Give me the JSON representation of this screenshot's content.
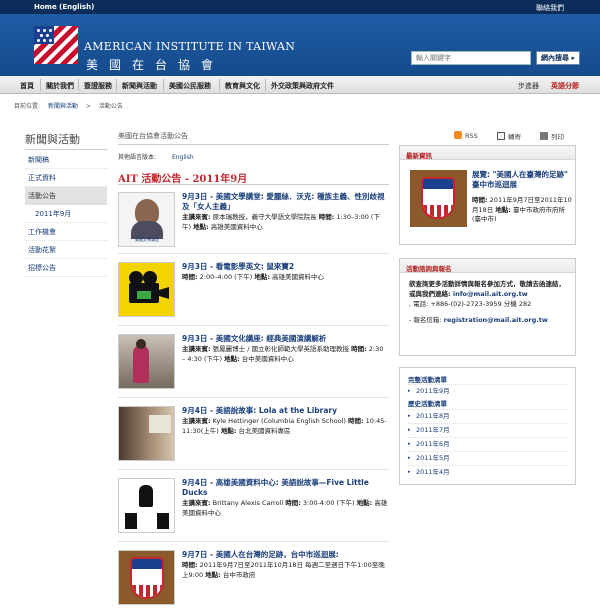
{
  "topbar": {
    "home": "Home (English)",
    "contact": "聯絡我們"
  },
  "brand": {
    "en": "AMERICAN INSTITUTE IN TAIWAN",
    "zh": "美國在台協會"
  },
  "search": {
    "placeholder": "輸入關鍵字",
    "button": "網內搜尋 ▸"
  },
  "nav": {
    "items": [
      "首頁",
      "關於我們",
      "簽證服務",
      "新聞與活動",
      "美國公民服務",
      "教育與文化",
      "外交政策與政府文件"
    ],
    "lang_simplified": "步進器",
    "lang_english": "英語分節"
  },
  "breadcrumb": {
    "label": "目前位置:",
    "level1": "新聞與活動",
    "arrow": ">",
    "level2": "活動公告"
  },
  "sidebar": {
    "title": "新聞與活動",
    "items": [
      "新聞稿",
      "正式資料",
      "活動公告",
      "2011年9月",
      "工作機會",
      "活動花絮",
      "招標公告"
    ]
  },
  "main": {
    "heading": "美國在台協會活動公告",
    "tools": {
      "rss": "RSS",
      "email": "轉寄",
      "print": "列印"
    },
    "lang_label": "其他語言版本:",
    "lang_link": "English",
    "title": "AIT 活動公告 - 2011年9月",
    "events": [
      {
        "title": "9月3日 - 美國文學講堂: 愛麗絲．沃克: 種族主義、性別歧視及「女人主義」",
        "desc_label1": "主講來賓:",
        "desc_val1": " 原本瑞教授，義守大學語文學院院長 ",
        "desc_label2": "時間:",
        "desc_val2": " 1:30–3:00 (下午) ",
        "desc_label3": "地點:",
        "desc_val3": " 高雄美國資料中心",
        "thumb_caption": "美國文學講堂"
      },
      {
        "title": "9月3日 - 看電影學英文: 鼠來寶2",
        "desc_label1": "時間:",
        "desc_val1": " 2:00–4:00 (下午) ",
        "desc_label2": "地點:",
        "desc_val2": " 高雄美國資料中心"
      },
      {
        "title": "9月3日 - 美國文化講座: 經典美國演講解析",
        "desc_label1": "主講來賓:",
        "desc_val1": " 張鳳麗博士 / 國立彰化師範大學英語系助理教授 ",
        "desc_label2": "時間:",
        "desc_val2": " 2:30 – 4:30 (下午) ",
        "desc_label3": "地點:",
        "desc_val3": " 台中美國資料中心"
      },
      {
        "title": "9月4日 - 美語說故事: Lola at the Library",
        "desc_label1": "主講來賓:",
        "desc_val1": " Kyle Hettinger (Columbia English School) ",
        "desc_label2": "時間:",
        "desc_val2": " 10:45-11:30(上午) ",
        "desc_label3": "地點:",
        "desc_val3": " 台北美國資料專區"
      },
      {
        "title": "9月4日 - 高雄美國資料中心: 美語說故事—Five Little Ducks",
        "desc_label1": "主講來賓:",
        "desc_val1": " Brittany Alexis Carroll ",
        "desc_label2": "時間:",
        "desc_val2": " 3:00-4:00 (下午) ",
        "desc_label3": "地點:",
        "desc_val3": " 高雄美國資料中心"
      },
      {
        "title": "9月7日 - 美國人在台灣的足跡，台中市巡迴展:",
        "desc_label1": "時間:",
        "desc_val1": " 2011年9月7日至2011年10月18日 每週二至週日下午1:00至晚上9:00 ",
        "desc_label2": "地點:",
        "desc_val2": " 台中市政府"
      }
    ]
  },
  "right": {
    "box1": {
      "head": "最新資訊",
      "title": "展覽: \"美國人在臺灣的足跡\" 臺中市巡迴展",
      "desc_label1": "時間:",
      "desc_val1": " 2011年9月7日至2011年10月18日 ",
      "desc_label2": "地點:",
      "desc_val2": " 臺中市政府市府所 (臺中市)"
    },
    "box2": {
      "head": "活動諮詢與報名",
      "line1": "欲查詢更多活動詳情與報名參加方式，敬請去函連結，或與我們連絡",
      "mail1_prefix": ": ",
      "mail1": "info@mail.ait.org.tw",
      "phone": ", 電話: +886-(02)-2723-3959 分機 282",
      "reg_label": "- 報名信箱: ",
      "reg_mail": "registration@mail.ait.org.tw"
    },
    "box3": {
      "full_label": "完整活動清單",
      "current": "2011年9月",
      "history_label": "歷史活動清單",
      "history": [
        "2011年8月",
        "2011年7月",
        "2011年6月",
        "2011年5月",
        "2011年4月"
      ]
    }
  }
}
